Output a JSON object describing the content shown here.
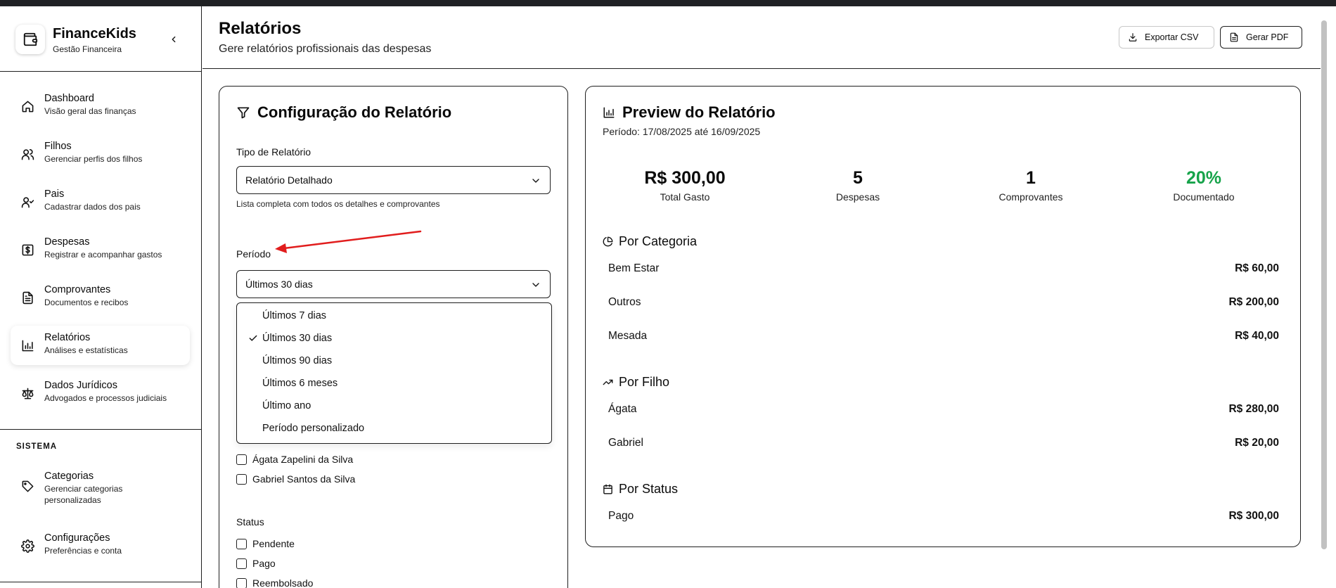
{
  "sidebar": {
    "brand_title": "FinanceKids",
    "brand_subtitle": "Gestão Financeira",
    "items": [
      {
        "label": "Dashboard",
        "desc": "Visão geral das finanças",
        "icon": "home-icon"
      },
      {
        "label": "Filhos",
        "desc": "Gerenciar perfis dos filhos",
        "icon": "users-icon"
      },
      {
        "label": "Pais",
        "desc": "Cadastrar dados dos pais",
        "icon": "user-check-icon"
      },
      {
        "label": "Despesas",
        "desc": "Registrar e acompanhar gastos",
        "icon": "dollar-icon"
      },
      {
        "label": "Comprovantes",
        "desc": "Documentos e recibos",
        "icon": "file-text-icon"
      },
      {
        "label": "Relatórios",
        "desc": "Análises e estatísticas",
        "icon": "bar-chart-icon",
        "active": true
      },
      {
        "label": "Dados Jurídicos",
        "desc": "Advogados e processos judiciais",
        "icon": "scale-icon"
      }
    ],
    "system_label": "SISTEMA",
    "system_items": [
      {
        "label": "Categorias",
        "desc_line1": "Gerenciar categorias",
        "desc_line2": "personalizadas",
        "icon": "tag-icon"
      },
      {
        "label": "Configurações",
        "desc": "Preferências e conta",
        "icon": "gear-icon"
      }
    ]
  },
  "header": {
    "title": "Relatórios",
    "subtitle": "Gere relatórios profissionais das despesas",
    "export_csv_label": "Exportar CSV",
    "generate_pdf_label": "Gerar PDF"
  },
  "config": {
    "title": "Configuração do Relatório",
    "report_type_label": "Tipo de Relatório",
    "report_type_value": "Relatório Detalhado",
    "report_type_help": "Lista completa com todos os detalhes e comprovantes",
    "period_label": "Período",
    "period_value": "Últimos 30 dias",
    "period_options": [
      {
        "label": "Últimos 7 dias",
        "selected": false
      },
      {
        "label": "Últimos 30 dias",
        "selected": true
      },
      {
        "label": "Últimos 90 dias",
        "selected": false
      },
      {
        "label": "Últimos 6 meses",
        "selected": false
      },
      {
        "label": "Último ano",
        "selected": false
      },
      {
        "label": "Período personalizado",
        "selected": false
      }
    ],
    "children": [
      "Ágata Zapelini da Silva",
      "Gabriel Santos da Silva"
    ],
    "status_label": "Status",
    "statuses": [
      "Pendente",
      "Pago",
      "Reembolsado"
    ]
  },
  "preview": {
    "title": "Preview do Relatório",
    "period_text": "Período: 17/08/2025 até 16/09/2025",
    "stats": [
      {
        "value": "R$ 300,00",
        "label": "Total Gasto",
        "color": "#0a0a0a"
      },
      {
        "value": "5",
        "label": "Despesas",
        "color": "#0a0a0a"
      },
      {
        "value": "1",
        "label": "Comprovantes",
        "color": "#0a0a0a"
      },
      {
        "value": "20%",
        "label": "Documentado",
        "color": "#16a34a"
      }
    ],
    "by_category_title": "Por Categoria",
    "by_category": [
      {
        "label": "Bem Estar",
        "value": "R$ 60,00"
      },
      {
        "label": "Outros",
        "value": "R$ 200,00"
      },
      {
        "label": "Mesada",
        "value": "R$ 40,00"
      }
    ],
    "by_child_title": "Por Filho",
    "by_child": [
      {
        "label": "Ágata",
        "value": "R$ 280,00"
      },
      {
        "label": "Gabriel",
        "value": "R$ 20,00"
      }
    ],
    "by_status_title": "Por Status",
    "by_status": [
      {
        "label": "Pago",
        "value": "R$ 300,00"
      }
    ]
  },
  "colors": {
    "accent_green": "#16a34a",
    "annotation_arrow": "#e11d1d",
    "border": "#1f1f1f"
  }
}
